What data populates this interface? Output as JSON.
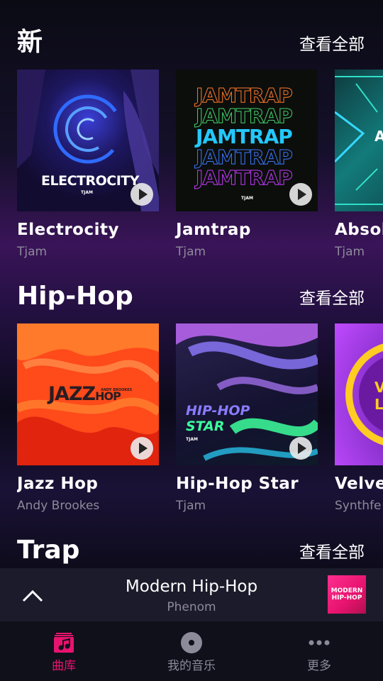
{
  "sections": [
    {
      "title": "新",
      "see_all": "查看全部",
      "cards": [
        {
          "title": "Electrocity",
          "artist": "Tjam",
          "art_text": "ELECTROCITY",
          "art_sub": "TJAM"
        },
        {
          "title": "Jamtrap",
          "artist": "Tjam",
          "art_text": "JAMTRAP",
          "art_sub": "TJAM"
        },
        {
          "title": "Absol",
          "artist": "Tjam",
          "art_text": "A"
        }
      ]
    },
    {
      "title": "Hip-Hop",
      "see_all": "查看全部",
      "cards": [
        {
          "title": "Jazz Hop",
          "artist": "Andy Brookes",
          "art_text": "JAZZ",
          "art_text2": "HOP",
          "art_sub": "ANDY BROOKES"
        },
        {
          "title": "Hip-Hop Star",
          "artist": "Tjam",
          "art_text": "HIP-HOP",
          "art_text2": "STAR",
          "art_sub": "TJAM"
        },
        {
          "title": "Velvet",
          "artist": "Synthfe",
          "art_text": "V",
          "art_text2": "L"
        }
      ]
    },
    {
      "title": "Trap",
      "see_all": "查看全部"
    }
  ],
  "mini_player": {
    "title": "Modern Hip-Hop",
    "artist": "Phenom",
    "art_line1": "MODERN",
    "art_line2": "HIP-HOP"
  },
  "nav": [
    {
      "label": "曲库",
      "icon": "music-library-icon",
      "active": true
    },
    {
      "label": "我的音乐",
      "icon": "disc-icon",
      "active": false
    },
    {
      "label": "更多",
      "icon": "more-icon",
      "active": false
    }
  ],
  "colors": {
    "accent": "#e8136f",
    "inactive": "#8d8a99"
  }
}
